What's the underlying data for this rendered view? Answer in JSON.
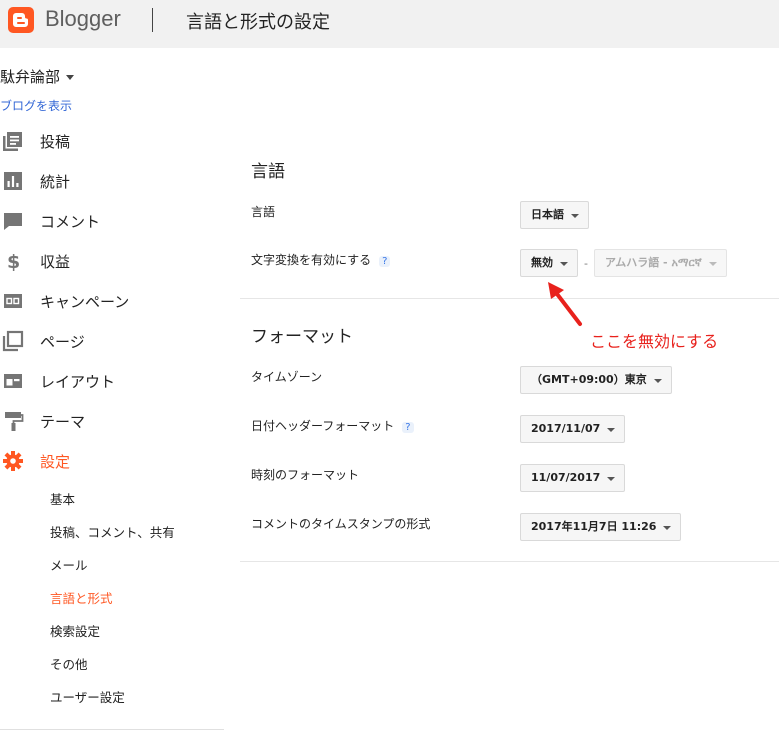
{
  "header": {
    "brand": "Blogger",
    "page_title": "言語と形式の設定"
  },
  "sidebar": {
    "blog_name": "駄弁論部",
    "view_blog": "ブログを表示",
    "items": [
      {
        "label": "投稿",
        "icon": "posts-icon"
      },
      {
        "label": "統計",
        "icon": "stats-icon"
      },
      {
        "label": "コメント",
        "icon": "comment-icon"
      },
      {
        "label": "収益",
        "icon": "dollar-icon"
      },
      {
        "label": "キャンペーン",
        "icon": "ad-icon"
      },
      {
        "label": "ページ",
        "icon": "pages-icon"
      },
      {
        "label": "レイアウト",
        "icon": "layout-icon"
      },
      {
        "label": "テーマ",
        "icon": "paint-roller-icon"
      },
      {
        "label": "設定",
        "icon": "gear-icon"
      }
    ],
    "sub_items": [
      "基本",
      "投稿、コメント、共有",
      "メール",
      "言語と形式",
      "検索設定",
      "その他",
      "ユーザー設定"
    ],
    "accent_color": "#ff5722"
  },
  "main": {
    "language_section": {
      "title": "言語",
      "language_label": "言語",
      "language_value": "日本語",
      "transliteration_label": "文字変換を有効にする",
      "help": "?",
      "transliteration_value": "無効",
      "transliteration_language": "アムハラ語 - አማርኛ"
    },
    "format_section": {
      "title": "フォーマット",
      "timezone_label": "タイムゾーン",
      "timezone_value": "（GMT+09:00）東京",
      "date_header_label": "日付ヘッダーフォーマット",
      "help": "?",
      "date_header_value": "2017/11/07",
      "time_format_label": "時刻のフォーマット",
      "time_format_value": "11/07/2017",
      "comment_timestamp_label": "コメントのタイムスタンプの形式",
      "comment_timestamp_value": "2017年11月7日 11:26"
    },
    "annotation": {
      "text": "ここを無効にする",
      "color": "#e8211c"
    }
  }
}
